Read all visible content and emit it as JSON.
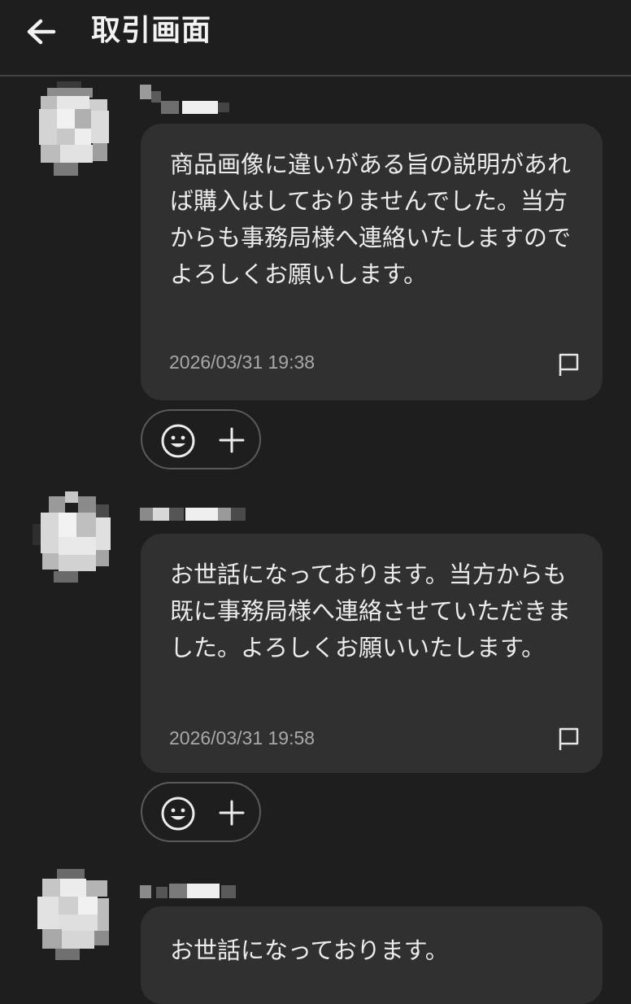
{
  "header": {
    "title": "取引画面",
    "back_icon": "arrow-left-icon"
  },
  "messages": [
    {
      "avatar": "blurred-avatar",
      "username": "",
      "text": "商品画像に違いがある旨の説明があれば購入はしておりませんでした。当方からも事務局様へ連絡いたしますのでよろしくお願いします。",
      "timestamp": "2026/03/31 19:38",
      "report_icon": "flag-icon",
      "reactions": {
        "emoji_icon": "smiley-icon",
        "add_icon": "plus-icon"
      }
    },
    {
      "avatar": "blurred-avatar",
      "username": "",
      "text": "お世話になっております。当方からも既に事務局様へ連絡させていただきました。よろしくお願いいたします。",
      "timestamp": "2026/03/31 19:58",
      "report_icon": "flag-icon",
      "reactions": {
        "emoji_icon": "smiley-icon",
        "add_icon": "plus-icon"
      }
    },
    {
      "avatar": "blurred-avatar",
      "username": "",
      "text": "お世話になっております。"
    }
  ],
  "colors": {
    "background": "#1e1e1e",
    "bubble": "#303030",
    "text": "#ececec",
    "timestamp": "#a8a8a8",
    "divider": "#444444"
  }
}
